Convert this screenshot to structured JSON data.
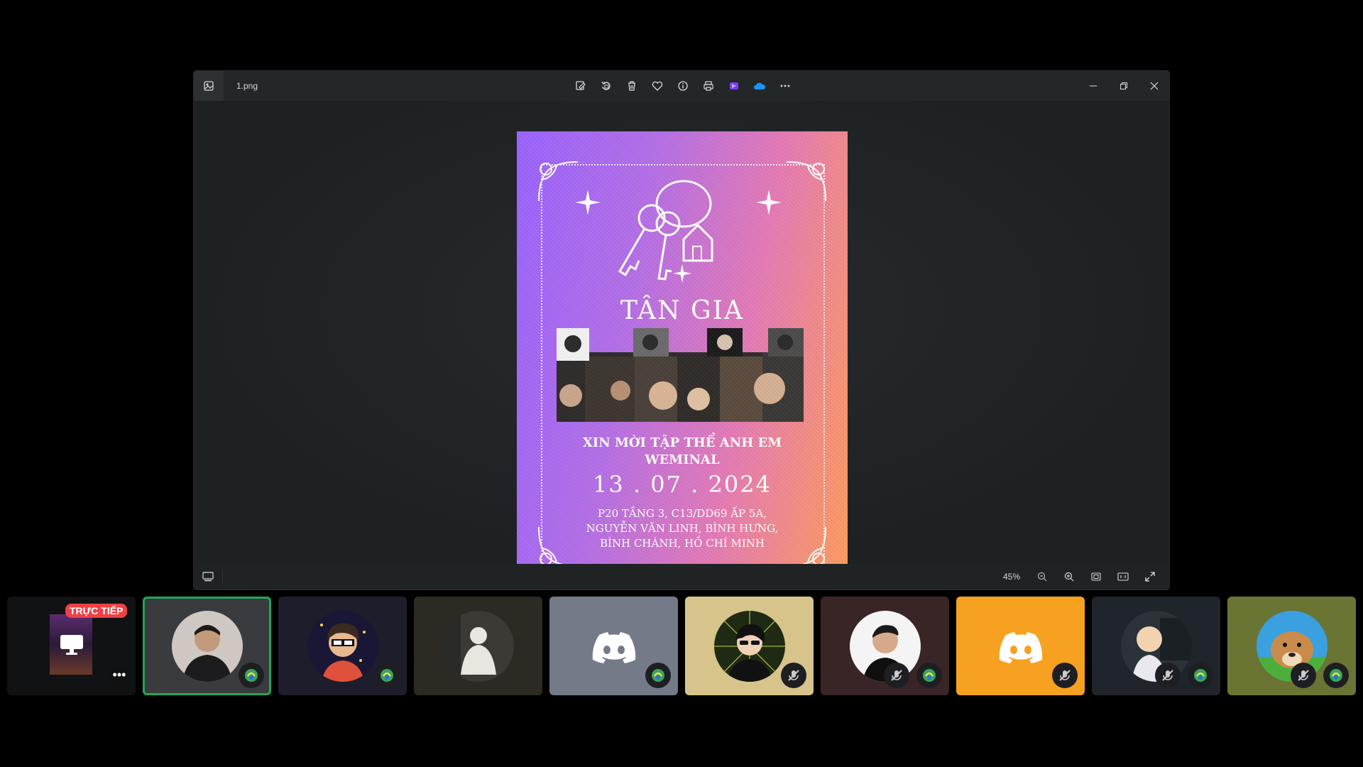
{
  "viewer": {
    "filename": "1.png",
    "zoom": "45%",
    "toolbar_icons": [
      "edit-icon",
      "rotate-icon",
      "delete-icon",
      "favorite-icon",
      "info-icon",
      "print-icon",
      "clipchamp-icon",
      "onedrive-icon",
      "more-icon"
    ],
    "window_controls": [
      "minimize-icon",
      "restore-icon",
      "close-icon"
    ]
  },
  "poster": {
    "title": "TÂN GIA",
    "invite_line1": "XIN MỜI TẬP THỂ ANH EM",
    "invite_line2": "WEMINAL",
    "date": "13 . 07 . 2024",
    "address_line1": "P20 TẦNG 3, C13/DD69 ẤP 5A,",
    "address_line2": "NGUYỄN VĂN LINH, BÌNH HƯNG,",
    "address_line3": "BÌNH CHÁNH, HỒ CHÍ MINH",
    "colors": {
      "gradient_start": "#9a63ff",
      "gradient_end": "#ff9c5b"
    }
  },
  "participants": {
    "live_label": "TRỰC TIẾP",
    "tiles": [
      {
        "name": "stream-tile",
        "bg": "#111214"
      },
      {
        "name": "participant-1",
        "bg": "#3a3b3e",
        "active": true
      },
      {
        "name": "participant-2",
        "bg": "#1e1d2b"
      },
      {
        "name": "participant-3",
        "bg": "#2c2a22"
      },
      {
        "name": "participant-4",
        "bg": "#747a88"
      },
      {
        "name": "participant-5",
        "bg": "#d6c48b"
      },
      {
        "name": "participant-6",
        "bg": "#3a2526"
      },
      {
        "name": "participant-7",
        "bg": "#f6a11f"
      },
      {
        "name": "participant-8",
        "bg": "#1f252b"
      },
      {
        "name": "participant-9",
        "bg": "#6a7433"
      }
    ]
  }
}
